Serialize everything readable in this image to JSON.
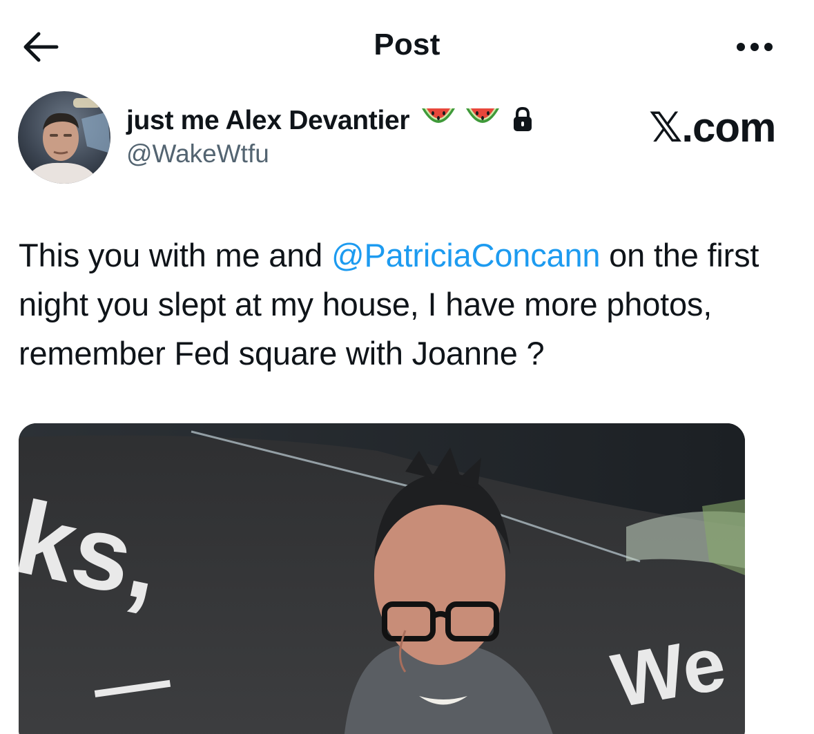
{
  "header": {
    "title": "Post",
    "back_icon": "arrow-left-icon",
    "more_icon": "more-horizontal-icon"
  },
  "author": {
    "display_name": "just me Alex Devantier",
    "badges": [
      "watermelon-emoji",
      "watermelon-emoji",
      "lock-icon"
    ],
    "handle": "@WakeWtfu"
  },
  "brand": {
    "label": "𝕏.com"
  },
  "post": {
    "text_before": "This you with me and ",
    "mention": "@PatriciaConcann",
    "text_after": " on the first night you slept at my house, I have more photos, remember Fed square with Joanne ?"
  },
  "media": {
    "banner_text_left": "ks,",
    "banner_text_right": "We"
  },
  "colors": {
    "text": "#0f1419",
    "secondary": "#536471",
    "link": "#1d9bf0",
    "background": "#ffffff"
  }
}
